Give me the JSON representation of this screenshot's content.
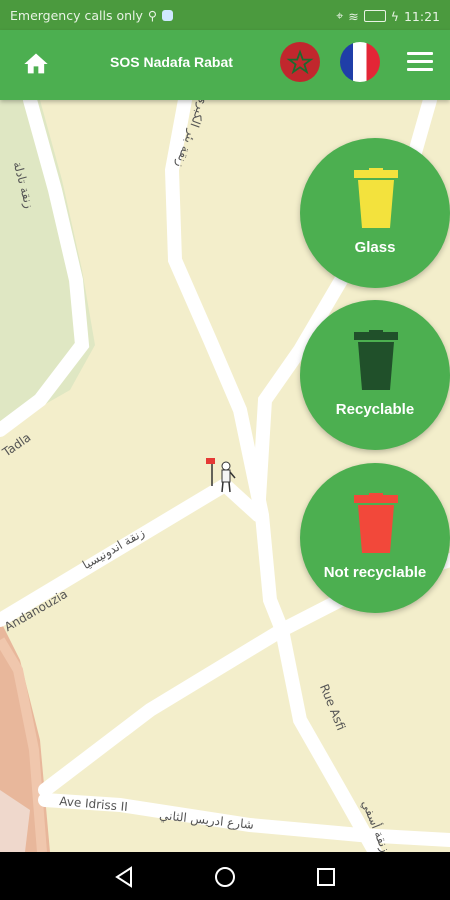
{
  "status_bar": {
    "carrier_text": "Emergency calls only",
    "time": "11:21"
  },
  "app_bar": {
    "title": "SOS Nadafa Rabat",
    "icons": [
      "home-icon",
      "morocco-flag-icon",
      "france-flag-icon",
      "menu-icon"
    ]
  },
  "map": {
    "street_labels": [
      "زنقة تادلة",
      "Tadla",
      "زنقة بئر الكبري",
      "زنقة اندونيسيا",
      "Andanouzia",
      "Rue Asfi",
      "زنقة أسفي",
      "Ave Idriss II",
      "شارع ادريس الثاني"
    ]
  },
  "bins": [
    {
      "label": "Glass",
      "color": "#f3e23d"
    },
    {
      "label": "Recyclable",
      "color": "#20502a"
    },
    {
      "label": "Not recyclable",
      "color": "#f2483a"
    }
  ],
  "colors": {
    "primary": "#4caf50",
    "status_bar": "#4b9a3e",
    "map_background": "#f3eecb"
  }
}
